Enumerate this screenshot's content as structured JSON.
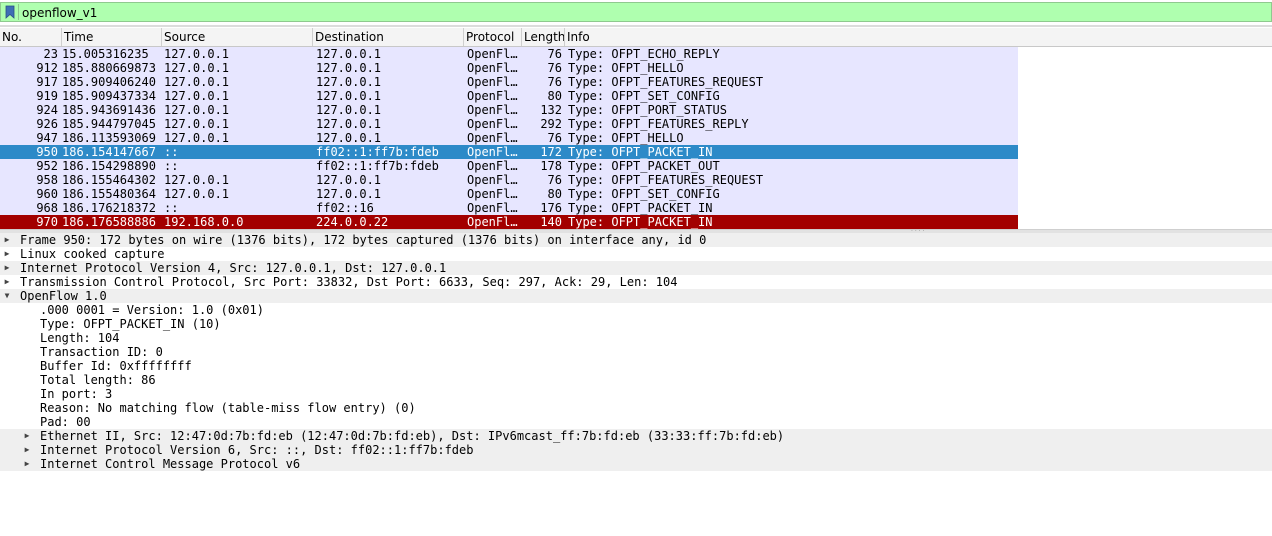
{
  "filter": {
    "value": "openflow_v1",
    "bookmark_icon": "bookmark-icon",
    "bg_color": "#afffaf"
  },
  "columns": [
    "No.",
    "Time",
    "Source",
    "Destination",
    "Protocol",
    "Length",
    "Info"
  ],
  "packets": [
    {
      "no": "23",
      "time": "15.005316235",
      "src": "127.0.0.1",
      "dst": "127.0.0.1",
      "proto": "OpenFl…",
      "len": "76",
      "info": "Type: OFPT_ECHO_REPLY"
    },
    {
      "no": "912",
      "time": "185.880669873",
      "src": "127.0.0.1",
      "dst": "127.0.0.1",
      "proto": "OpenFl…",
      "len": "76",
      "info": "Type: OFPT_HELLO"
    },
    {
      "no": "917",
      "time": "185.909406240",
      "src": "127.0.0.1",
      "dst": "127.0.0.1",
      "proto": "OpenFl…",
      "len": "76",
      "info": "Type: OFPT_FEATURES_REQUEST"
    },
    {
      "no": "919",
      "time": "185.909437334",
      "src": "127.0.0.1",
      "dst": "127.0.0.1",
      "proto": "OpenFl…",
      "len": "80",
      "info": "Type: OFPT_SET_CONFIG"
    },
    {
      "no": "924",
      "time": "185.943691436",
      "src": "127.0.0.1",
      "dst": "127.0.0.1",
      "proto": "OpenFl…",
      "len": "132",
      "info": "Type: OFPT_PORT_STATUS"
    },
    {
      "no": "926",
      "time": "185.944797045",
      "src": "127.0.0.1",
      "dst": "127.0.0.1",
      "proto": "OpenFl…",
      "len": "292",
      "info": "Type: OFPT_FEATURES_REPLY"
    },
    {
      "no": "947",
      "time": "186.113593069",
      "src": "127.0.0.1",
      "dst": "127.0.0.1",
      "proto": "OpenFl…",
      "len": "76",
      "info": "Type: OFPT_HELLO"
    },
    {
      "no": "950",
      "time": "186.154147667",
      "src": "::",
      "dst": "ff02::1:ff7b:fdeb",
      "proto": "OpenFl…",
      "len": "172",
      "info": "Type: OFPT_PACKET_IN",
      "state": "selected"
    },
    {
      "no": "952",
      "time": "186.154298890",
      "src": "::",
      "dst": "ff02::1:ff7b:fdeb",
      "proto": "OpenFl…",
      "len": "178",
      "info": "Type: OFPT_PACKET_OUT"
    },
    {
      "no": "958",
      "time": "186.155464302",
      "src": "127.0.0.1",
      "dst": "127.0.0.1",
      "proto": "OpenFl…",
      "len": "76",
      "info": "Type: OFPT_FEATURES_REQUEST"
    },
    {
      "no": "960",
      "time": "186.155480364",
      "src": "127.0.0.1",
      "dst": "127.0.0.1",
      "proto": "OpenFl…",
      "len": "80",
      "info": "Type: OFPT_SET_CONFIG"
    },
    {
      "no": "968",
      "time": "186.176218372",
      "src": "::",
      "dst": "ff02::16",
      "proto": "OpenFl…",
      "len": "176",
      "info": "Type: OFPT_PACKET_IN"
    },
    {
      "no": "970",
      "time": "186.176588886",
      "src": "192.168.0.0",
      "dst": "224.0.0.22",
      "proto": "OpenFl…",
      "len": "140",
      "info": "Type: OFPT_PACKET_IN",
      "state": "marked"
    }
  ],
  "details": [
    {
      "text": "Frame 950: 172 bytes on wire (1376 bits), 172 bytes captured (1376 bits) on interface any, id 0",
      "level": 0,
      "arrow": "collapsed",
      "alt": true
    },
    {
      "text": "Linux cooked capture",
      "level": 0,
      "arrow": "collapsed",
      "alt": false
    },
    {
      "text": "Internet Protocol Version 4, Src: 127.0.0.1, Dst: 127.0.0.1",
      "level": 0,
      "arrow": "collapsed",
      "alt": true
    },
    {
      "text": "Transmission Control Protocol, Src Port: 33832, Dst Port: 6633, Seq: 297, Ack: 29, Len: 104",
      "level": 0,
      "arrow": "collapsed",
      "alt": false
    },
    {
      "text": "OpenFlow 1.0",
      "level": 0,
      "arrow": "expanded",
      "alt": true
    },
    {
      "text": ".000 0001 = Version: 1.0 (0x01)",
      "level": 1,
      "arrow": "none",
      "alt": false
    },
    {
      "text": "Type: OFPT_PACKET_IN (10)",
      "level": 1,
      "arrow": "none",
      "alt": false
    },
    {
      "text": "Length: 104",
      "level": 1,
      "arrow": "none",
      "alt": false
    },
    {
      "text": "Transaction ID: 0",
      "level": 1,
      "arrow": "none",
      "alt": false
    },
    {
      "text": "Buffer Id: 0xffffffff",
      "level": 1,
      "arrow": "none",
      "alt": false
    },
    {
      "text": "Total length: 86",
      "level": 1,
      "arrow": "none",
      "alt": false
    },
    {
      "text": "In port: 3",
      "level": 1,
      "arrow": "none",
      "alt": false
    },
    {
      "text": "Reason: No matching flow (table-miss flow entry) (0)",
      "level": 1,
      "arrow": "none",
      "alt": false
    },
    {
      "text": "Pad: 00",
      "level": 1,
      "arrow": "none",
      "alt": false
    },
    {
      "text": "Ethernet II, Src: 12:47:0d:7b:fd:eb (12:47:0d:7b:fd:eb), Dst: IPv6mcast_ff:7b:fd:eb (33:33:ff:7b:fd:eb)",
      "level": 1,
      "arrow": "collapsed",
      "alt": true
    },
    {
      "text": "Internet Protocol Version 6, Src: ::, Dst: ff02::1:ff7b:fdeb",
      "level": 1,
      "arrow": "collapsed",
      "alt": true
    },
    {
      "text": "Internet Control Message Protocol v6",
      "level": 1,
      "arrow": "collapsed",
      "alt": true
    }
  ],
  "colors": {
    "row_bg": "#e7e6ff",
    "selected_bg": "#2d8ac8",
    "marked_bg": "#a30000"
  }
}
